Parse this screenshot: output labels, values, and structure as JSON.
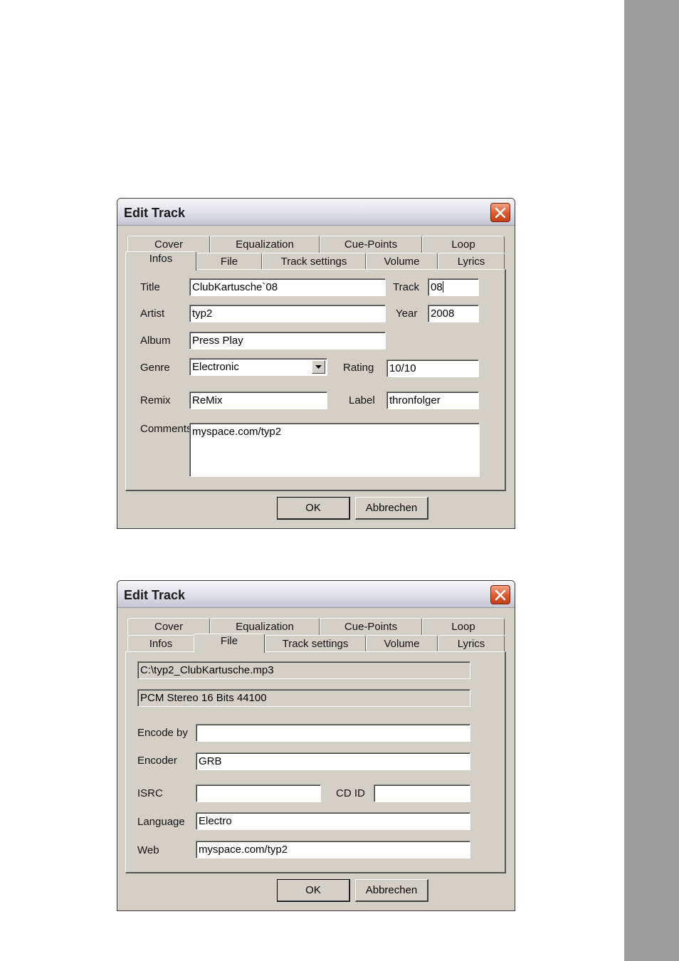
{
  "dialog1": {
    "title": "Edit Track",
    "tabs_row1": [
      "Cover",
      "Equalization",
      "Cue-Points",
      "Loop"
    ],
    "tabs_row2": [
      "Infos",
      "File",
      "Track settings",
      "Volume",
      "Lyrics"
    ],
    "active_tab": "Infos",
    "labels": {
      "title": "Title",
      "track": "Track",
      "artist": "Artist",
      "year": "Year",
      "album": "Album",
      "genre": "Genre",
      "rating": "Rating",
      "remix": "Remix",
      "label": "Label",
      "comments": "Comments"
    },
    "values": {
      "title": "ClubKartusche`08",
      "track": "08",
      "artist": "typ2",
      "year": "2008",
      "album": "Press Play",
      "genre": "Electronic",
      "rating": "10/10",
      "remix": "ReMix",
      "label": "thronfolger",
      "comments": "myspace.com/typ2"
    },
    "ok_label": "OK",
    "cancel_label": "Abbrechen"
  },
  "dialog2": {
    "title": "Edit Track",
    "tabs_row1": [
      "Cover",
      "Equalization",
      "Cue-Points",
      "Loop"
    ],
    "tabs_row2": [
      "Infos",
      "File",
      "Track settings",
      "Volume",
      "Lyrics"
    ],
    "active_tab": "File",
    "file_path": "C:\\typ2_ClubKartusche.mp3",
    "format_info": "PCM Stereo  16 Bits  44100",
    "labels": {
      "encode_by": "Encode by",
      "encoder": "Encoder",
      "isrc": "ISRC",
      "cd_id": "CD ID",
      "language": "Language",
      "web": "Web"
    },
    "values": {
      "encode_by": "",
      "encoder": "GRB",
      "isrc": "",
      "cd_id": "",
      "language": "Electro",
      "web": "myspace.com/typ2"
    },
    "ok_label": "OK",
    "cancel_label": "Abbrechen"
  },
  "icons": {
    "close": "close-x-icon",
    "dropdown": "chevron-down-icon"
  },
  "colors": {
    "dialog_bg": "#d4d0c8",
    "close_button": "#dd5a2e",
    "side_bar": "#9c9c9c"
  }
}
